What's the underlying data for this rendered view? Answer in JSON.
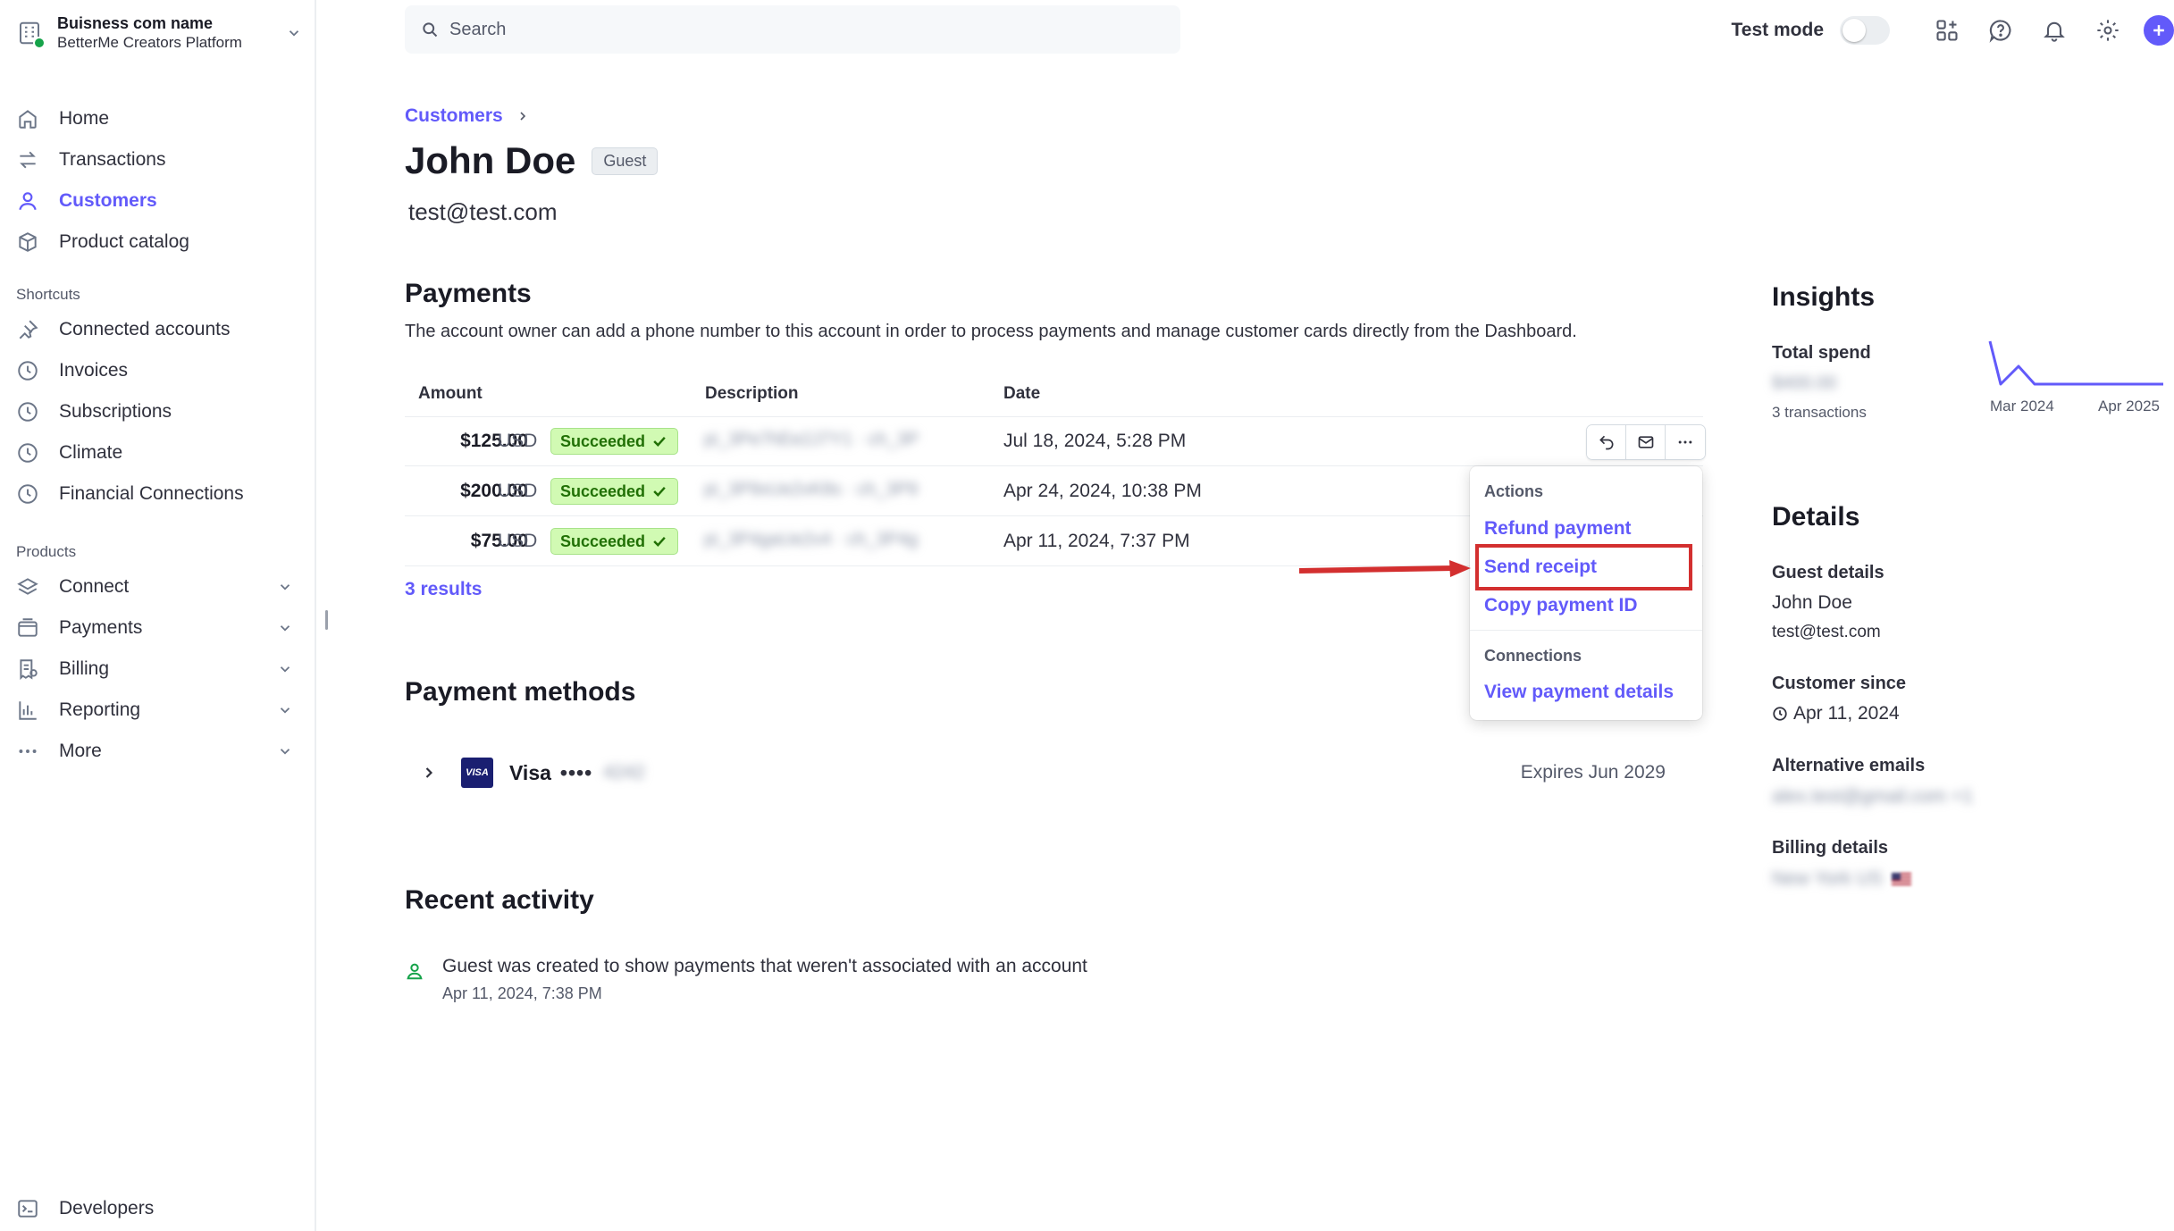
{
  "account": {
    "business_name": "Buisness com name",
    "platform": "BetterMe Creators Platform"
  },
  "sidebar": {
    "main": [
      {
        "label": "Home",
        "icon": "home-icon"
      },
      {
        "label": "Transactions",
        "icon": "transfer-icon"
      },
      {
        "label": "Customers",
        "icon": "user-icon",
        "active": true
      },
      {
        "label": "Product catalog",
        "icon": "box-icon"
      }
    ],
    "shortcuts_heading": "Shortcuts",
    "shortcuts": [
      {
        "label": "Connected accounts",
        "icon": "pin-icon"
      },
      {
        "label": "Invoices",
        "icon": "clock-icon"
      },
      {
        "label": "Subscriptions",
        "icon": "clock-icon"
      },
      {
        "label": "Climate",
        "icon": "clock-icon"
      },
      {
        "label": "Financial Connections",
        "icon": "clock-icon"
      }
    ],
    "products_heading": "Products",
    "products": [
      {
        "label": "Connect",
        "icon": "layers-icon"
      },
      {
        "label": "Payments",
        "icon": "wallet-icon"
      },
      {
        "label": "Billing",
        "icon": "receipt-icon"
      },
      {
        "label": "Reporting",
        "icon": "bar-chart-icon"
      },
      {
        "label": "More",
        "icon": "ellipsis-icon"
      }
    ],
    "developers": "Developers"
  },
  "topbar": {
    "search_placeholder": "Search",
    "test_mode_label": "Test mode",
    "test_mode_on": false
  },
  "breadcrumb": {
    "parent": "Customers"
  },
  "customer": {
    "name": "John Doe",
    "badge": "Guest",
    "email": "test@test.com"
  },
  "payments": {
    "heading": "Payments",
    "description": "The account owner can add a phone number to this account in order to process payments and manage customer cards directly from the Dashboard.",
    "columns": {
      "amount": "Amount",
      "description": "Description",
      "date": "Date"
    },
    "rows": [
      {
        "amount": "$125.00",
        "currency": "USD",
        "status": "Succeeded",
        "description": "pi_3Pe7hEe2J7Y1 · ch_3P",
        "date": "Jul 18, 2024, 5:28 PM"
      },
      {
        "amount": "$200.00",
        "currency": "USD",
        "status": "Succeeded",
        "description": "pi_3P9xUe2vK8s · ch_3P9",
        "date": "Apr 24, 2024, 10:38 PM"
      },
      {
        "amount": "$75.00",
        "currency": "USD",
        "status": "Succeeded",
        "description": "pi_3P4gaUe2v4 · ch_3P4g",
        "date": "Apr 11, 2024, 7:37 PM"
      }
    ],
    "results": "3 results"
  },
  "menu": {
    "actions_heading": "Actions",
    "refund": "Refund payment",
    "send_receipt": "Send receipt",
    "copy_id": "Copy payment ID",
    "connections_heading": "Connections",
    "view_details": "View payment details"
  },
  "payment_methods": {
    "heading": "Payment methods",
    "brand": "Visa",
    "dots": "••••",
    "last4": "4242",
    "expires": "Expires Jun 2029",
    "logo_text": "VISA"
  },
  "recent_activity": {
    "heading": "Recent activity",
    "text": "Guest was created to show payments that weren't associated with an account",
    "time": "Apr 11, 2024, 7:38 PM"
  },
  "insights": {
    "heading": "Insights",
    "total_spend_label": "Total spend",
    "total_spend_value": "$400.00",
    "transactions": "3 transactions",
    "sparkline_start": "Mar 2024",
    "sparkline_end": "Apr 2025"
  },
  "details": {
    "heading": "Details",
    "guest_label": "Guest details",
    "guest_name": "John Doe",
    "guest_email": "test@test.com",
    "since_label": "Customer since",
    "since_value": "Apr 11, 2024",
    "alt_label": "Alternative emails",
    "alt_value": "alex.test@gmail.com +1",
    "billing_label": "Billing details",
    "billing_value": "New York US"
  },
  "colors": {
    "accent": "#625afa",
    "success_bg": "#d1fab3",
    "success_text": "#217005",
    "annotation_red": "#d32f2f"
  }
}
